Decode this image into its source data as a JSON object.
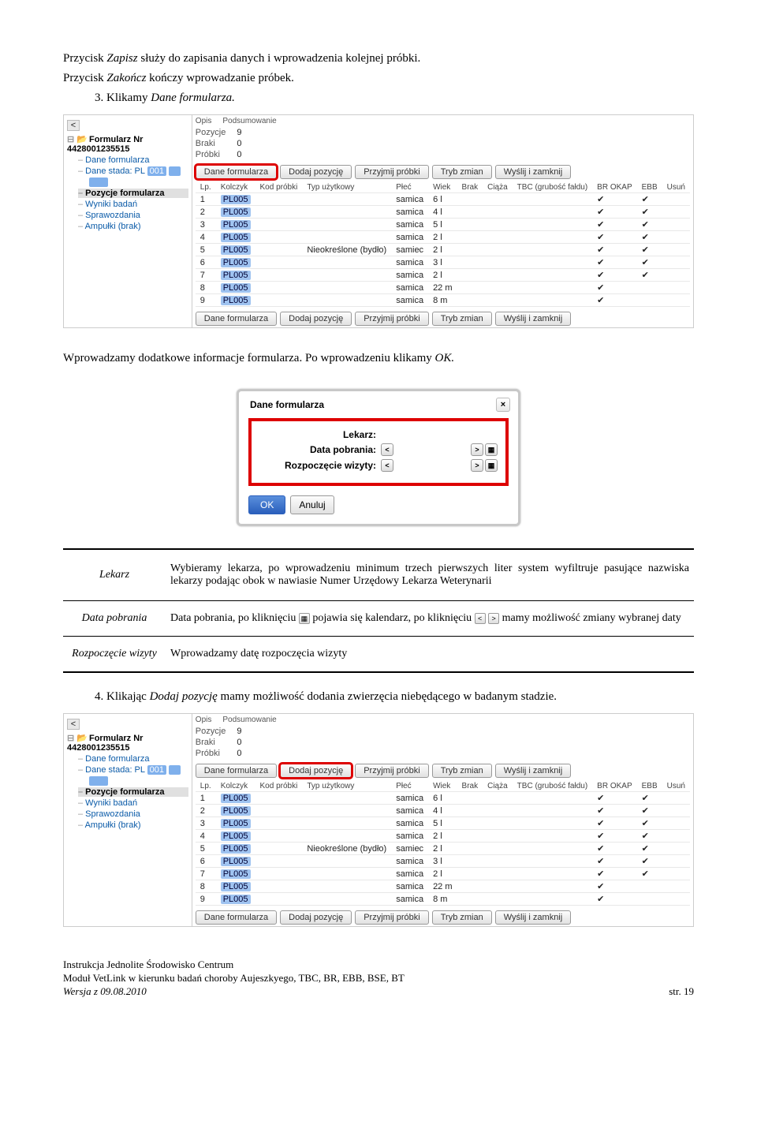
{
  "intro": {
    "line1_a": "Przycisk ",
    "line1_b": "Zapisz",
    "line1_c": " służy do zapisania danych i wprowadzenia kolejnej próbki.",
    "line2_a": "Przycisk ",
    "line2_b": "Zakończ",
    "line2_c": " kończy wprowadzanie próbek.",
    "step3": "3. Klikamy ",
    "step3_i": "Dane formularza.",
    "mid1": "Wprowadzamy dodatkowe informacje formularza. Po wprowadzeniu klikamy ",
    "mid1_i": "OK."
  },
  "tree": {
    "root": "Formularz Nr 4428001235515",
    "items": [
      "Dane formularza",
      "Dane stada: PL",
      "Pozycje formularza",
      "Wyniki badań",
      "Sprawozdania",
      "Ampułki (brak)"
    ],
    "stado_num": "001"
  },
  "summary": {
    "tabs": [
      "Opis",
      "Podsumowanie"
    ],
    "rows": [
      [
        "Pozycje",
        "9"
      ],
      [
        "Braki",
        "0"
      ],
      [
        "Próbki",
        "0"
      ]
    ]
  },
  "buttons": [
    "Dane formularza",
    "Dodaj pozycję",
    "Przyjmij próbki",
    "Tryb zmian",
    "Wyślij i zamknij"
  ],
  "grid": {
    "headers": [
      "Lp.",
      "Kolczyk",
      "Kod próbki",
      "Typ użytkowy",
      "Płeć",
      "Wiek",
      "Brak",
      "Ciąża",
      "TBC (grubość fałdu)",
      "BR OKAP",
      "EBB",
      "Usuń"
    ],
    "rows": [
      {
        "lp": "1",
        "kol": "PL005",
        "typ": "",
        "plec": "samica",
        "wiek": "6 l",
        "br": "✔",
        "ebb": "✔"
      },
      {
        "lp": "2",
        "kol": "PL005",
        "typ": "",
        "plec": "samica",
        "wiek": "4 l",
        "br": "✔",
        "ebb": "✔"
      },
      {
        "lp": "3",
        "kol": "PL005",
        "typ": "",
        "plec": "samica",
        "wiek": "5 l",
        "br": "✔",
        "ebb": "✔"
      },
      {
        "lp": "4",
        "kol": "PL005",
        "typ": "",
        "plec": "samica",
        "wiek": "2 l",
        "br": "✔",
        "ebb": "✔"
      },
      {
        "lp": "5",
        "kol": "PL005",
        "typ": "Nieokreślone (bydło)",
        "plec": "samiec",
        "wiek": "2 l",
        "br": "✔",
        "ebb": "✔"
      },
      {
        "lp": "6",
        "kol": "PL005",
        "typ": "",
        "plec": "samica",
        "wiek": "3 l",
        "br": "✔",
        "ebb": "✔"
      },
      {
        "lp": "7",
        "kol": "PL005",
        "typ": "",
        "plec": "samica",
        "wiek": "2 l",
        "br": "✔",
        "ebb": "✔"
      },
      {
        "lp": "8",
        "kol": "PL005",
        "typ": "",
        "plec": "samica",
        "wiek": "22 m",
        "br": "✔",
        "ebb": ""
      },
      {
        "lp": "9",
        "kol": "PL005",
        "typ": "",
        "plec": "samica",
        "wiek": "8 m",
        "br": "✔",
        "ebb": ""
      }
    ]
  },
  "dialog": {
    "title": "Dane formularza",
    "lekarz": "Lekarz:",
    "data_p": "Data pobrania:",
    "rozp": "Rozpoczęcie wizyty:",
    "ok": "OK",
    "cancel": "Anuluj"
  },
  "defs": {
    "lekarz_l": "Lekarz",
    "lekarz_t": "Wybieramy lekarza, po wprowadzeniu minimum trzech pierwszych liter system wyfiltruje pasujące nazwiska lekarzy podając obok w nawiasie Numer Urzędowy Lekarza Weterynarii",
    "data_l": "Data pobrania",
    "data_t1": "Data pobrania, po kliknięciu ",
    "data_t2": " pojawia się kalendarz, po kliknięciu ",
    "data_t3": " mamy możliwość zmiany wybranej daty",
    "rozp_l": "Rozpoczęcie wizyty",
    "rozp_t": "Wprowadzamy datę rozpoczęcia wizyty"
  },
  "step4": {
    "a": "4. Klikając ",
    "b": "Dodaj pozycję",
    "c": " mamy możliwość dodania zwierzęcia niebędącego w badanym stadzie."
  },
  "footer": {
    "l1": "Instrukcja Jednolite Środowisko Centrum",
    "l2": "Moduł VetLink w kierunku badań choroby Aujeszkyego, TBC, BR, EBB, BSE, BT",
    "l3": "Wersja z 09.08.2010",
    "r": "str. 19"
  }
}
